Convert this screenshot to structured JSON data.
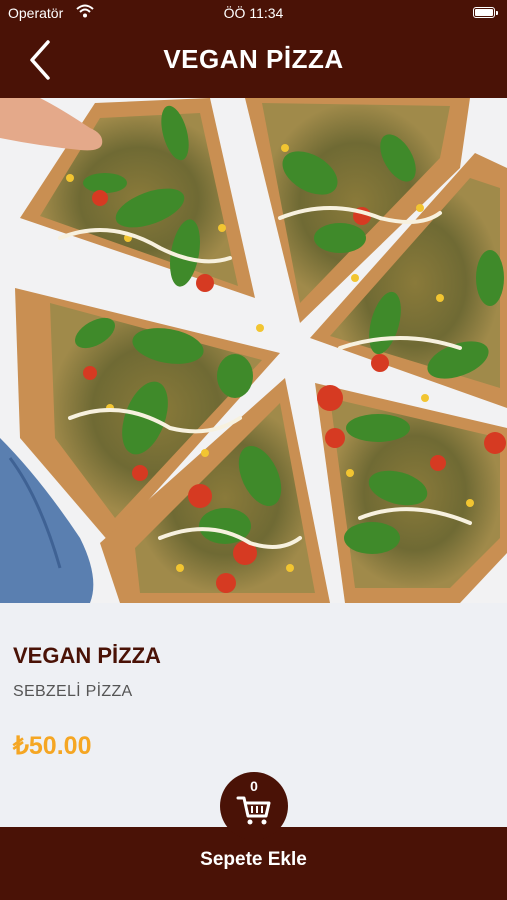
{
  "status_bar": {
    "carrier": "Operatör",
    "time": "ÖÖ 11:34"
  },
  "header": {
    "title": "VEGAN PİZZA",
    "back_icon": "chevron-left-icon"
  },
  "product": {
    "name": "VEGAN PİZZA",
    "description": "SEBZELİ PİZZA",
    "price": "₺50.00",
    "image": "vegan-pizza-photo"
  },
  "cart": {
    "count": "0",
    "icon": "cart-icon"
  },
  "action": {
    "add_to_cart_label": "Sepete Ekle"
  },
  "colors": {
    "brand": "#4a1206",
    "price": "#f5a623",
    "background": "#eef0f4"
  }
}
